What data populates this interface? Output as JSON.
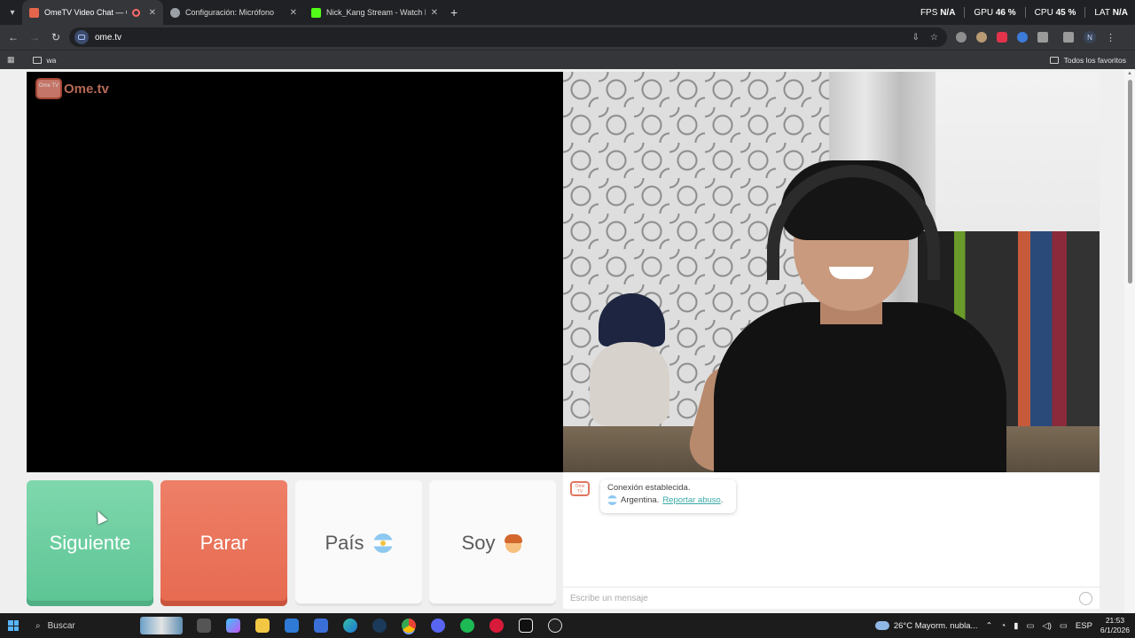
{
  "browser": {
    "tabs": [
      {
        "title": "OmeTV Video Chat — Ome",
        "active": true,
        "favicon_color": "#e5654c"
      },
      {
        "title": "Configuración: Micrófono",
        "active": false,
        "favicon_color": "#9aa0a6"
      },
      {
        "title": "Nick_Kang Stream - Watch Live",
        "active": false,
        "favicon_color": "#53fc18"
      }
    ],
    "new_tab": "+",
    "perf": [
      {
        "label": "FPS",
        "value": "N/A"
      },
      {
        "label": "GPU",
        "value": "46 %"
      },
      {
        "label": "CPU",
        "value": "45 %"
      },
      {
        "label": "LAT",
        "value": "N/A"
      }
    ],
    "url": "ome.tv",
    "profile_initial": "N",
    "bookmarks": [
      {
        "label": "wa"
      }
    ],
    "all_bookmarks_label": "Todos los favoritos"
  },
  "app": {
    "logo_text": "Ome.tv",
    "logo_badge": "Ome TV",
    "buttons": {
      "next": "Siguiente",
      "stop": "Parar",
      "country": "País",
      "gender": "Soy"
    },
    "chat": {
      "connected": "Conexión establecida.",
      "country": "Argentina.",
      "report": "Reportar abuso",
      "report_suffix": ".",
      "input_placeholder": "Escribe un mensaje"
    },
    "colors": {
      "next": "#6fd1a3",
      "stop": "#ea735a",
      "link": "#3aa8a8"
    }
  },
  "taskbar": {
    "search_label": "Buscar",
    "weather": "26°C  Mayorm. nubla...",
    "language": "ESP",
    "time": "21:53",
    "date": "6/1/2026",
    "icons": [
      "task-view-icon",
      "copilot-icon",
      "file-explorer-icon",
      "mail-icon",
      "store-icon",
      "edge-icon",
      "steam-icon",
      "chrome-icon",
      "discord-icon",
      "spotify-icon",
      "media-player-icon",
      "capcut-icon",
      "obs-icon"
    ]
  }
}
